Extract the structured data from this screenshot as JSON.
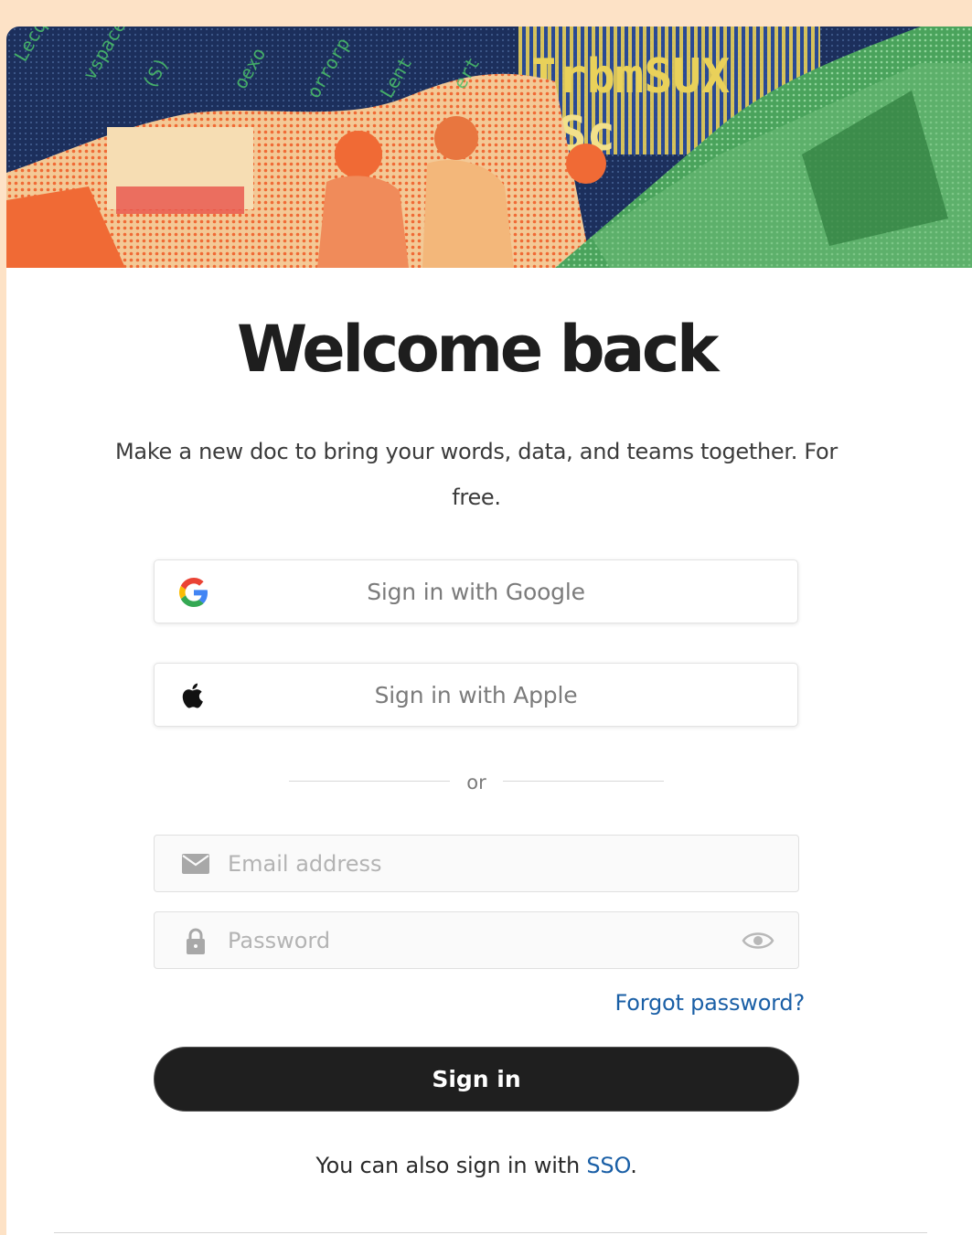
{
  "heading": {
    "title": "Welcome back",
    "subtitle": "Make a new doc to bring your words, data, and teams together. For free."
  },
  "oauth": {
    "google_label": "Sign in with Google",
    "apple_label": "Sign in with Apple"
  },
  "divider": {
    "text": "or"
  },
  "form": {
    "email_placeholder": "Email address",
    "email_value": "",
    "password_placeholder": "Password",
    "password_value": "",
    "forgot_label": "Forgot password?",
    "submit_label": "Sign in"
  },
  "sso": {
    "prefix": "You can also sign in with ",
    "link_label": "SSO",
    "suffix": "."
  },
  "icons": {
    "google": "google-logo-icon",
    "apple": "apple-logo-icon",
    "email": "mail-icon",
    "password": "lock-icon",
    "reveal": "eye-icon"
  },
  "colors": {
    "background": "#fde2c6",
    "link": "#1a5fa6",
    "primary_button": "#1f1f1f",
    "hero_navy": "#1c2f5c",
    "hero_orange": "#f06a35",
    "hero_green": "#3a9a4e",
    "hero_yellow": "#e9d15a"
  }
}
